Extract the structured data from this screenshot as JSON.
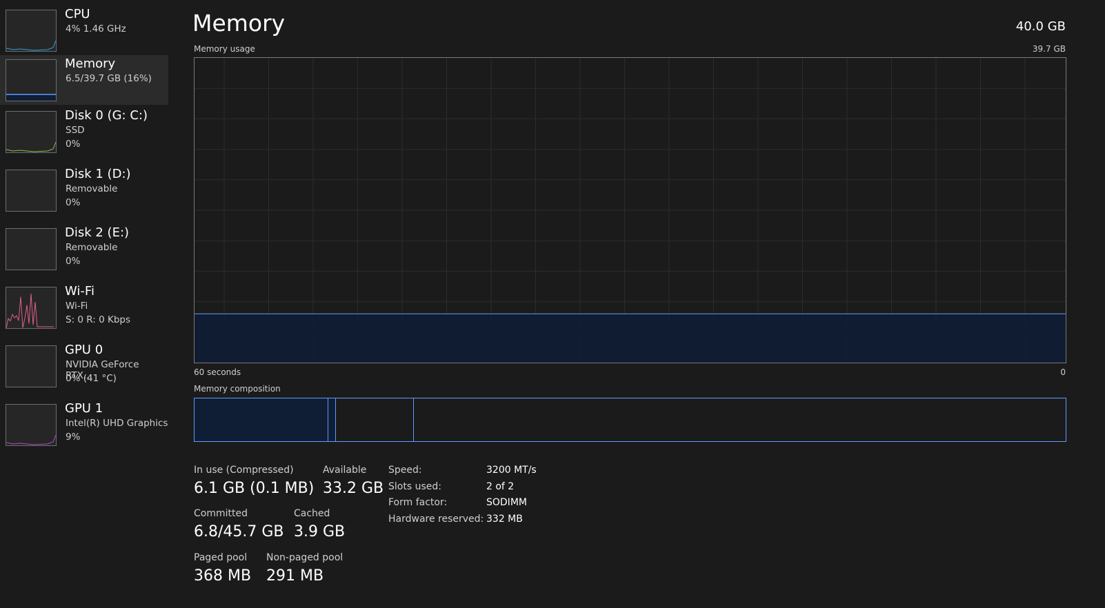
{
  "sidebar": {
    "items": [
      {
        "name": "CPU",
        "line1": "4% 1.46 GHz",
        "line2": "",
        "color": "#2fa5d8"
      },
      {
        "name": "Memory",
        "line1": "6.5/39.7 GB (16%)",
        "line2": "",
        "color": "#5e9cff",
        "selected": true
      },
      {
        "name": "Disk 0 (G: C:)",
        "line1": "SSD",
        "line2": "0%",
        "color": "#8bc34a"
      },
      {
        "name": "Disk 1 (D:)",
        "line1": "Removable",
        "line2": "0%",
        "color": "#8bc34a"
      },
      {
        "name": "Disk 2 (E:)",
        "line1": "Removable",
        "line2": "0%",
        "color": "#8bc34a"
      },
      {
        "name": "Wi-Fi",
        "line1": "Wi-Fi",
        "line2": "S: 0 R: 0 Kbps",
        "color": "#e0608a"
      },
      {
        "name": "GPU 0",
        "line1": "NVIDIA GeForce RTX...",
        "line2": "0% (41 °C)",
        "color": "#b648d8"
      },
      {
        "name": "GPU 1",
        "line1": "Intel(R) UHD Graphics",
        "line2": "9%",
        "color": "#b648d8"
      }
    ]
  },
  "main": {
    "title": "Memory",
    "total": "40.0 GB",
    "usage_label": "Memory usage",
    "usage_max": "39.7 GB",
    "x_left": "60 seconds",
    "x_right": "0",
    "usage_fraction": 0.16,
    "composition_label": "Memory composition",
    "composition_gb": {
      "in_use": 6.1,
      "modified": 0.35,
      "standby": 3.55,
      "free": 29.7
    },
    "stats": {
      "in_use_label": "In use (Compressed)",
      "in_use": "6.1 GB (0.1 MB)",
      "available_label": "Available",
      "available": "33.2 GB",
      "committed_label": "Committed",
      "committed": "6.8/45.7 GB",
      "cached_label": "Cached",
      "cached": "3.9 GB",
      "paged_label": "Paged pool",
      "paged": "368 MB",
      "nonpaged_label": "Non-paged pool",
      "nonpaged": "291 MB"
    },
    "specs": [
      {
        "k": "Speed:",
        "v": "3200 MT/s"
      },
      {
        "k": "Slots used:",
        "v": "2 of 2"
      },
      {
        "k": "Form factor:",
        "v": "SODIMM"
      },
      {
        "k": "Hardware reserved:",
        "v": "332 MB"
      }
    ],
    "accent": "#5e9cff",
    "fill": "#0f1d35"
  }
}
